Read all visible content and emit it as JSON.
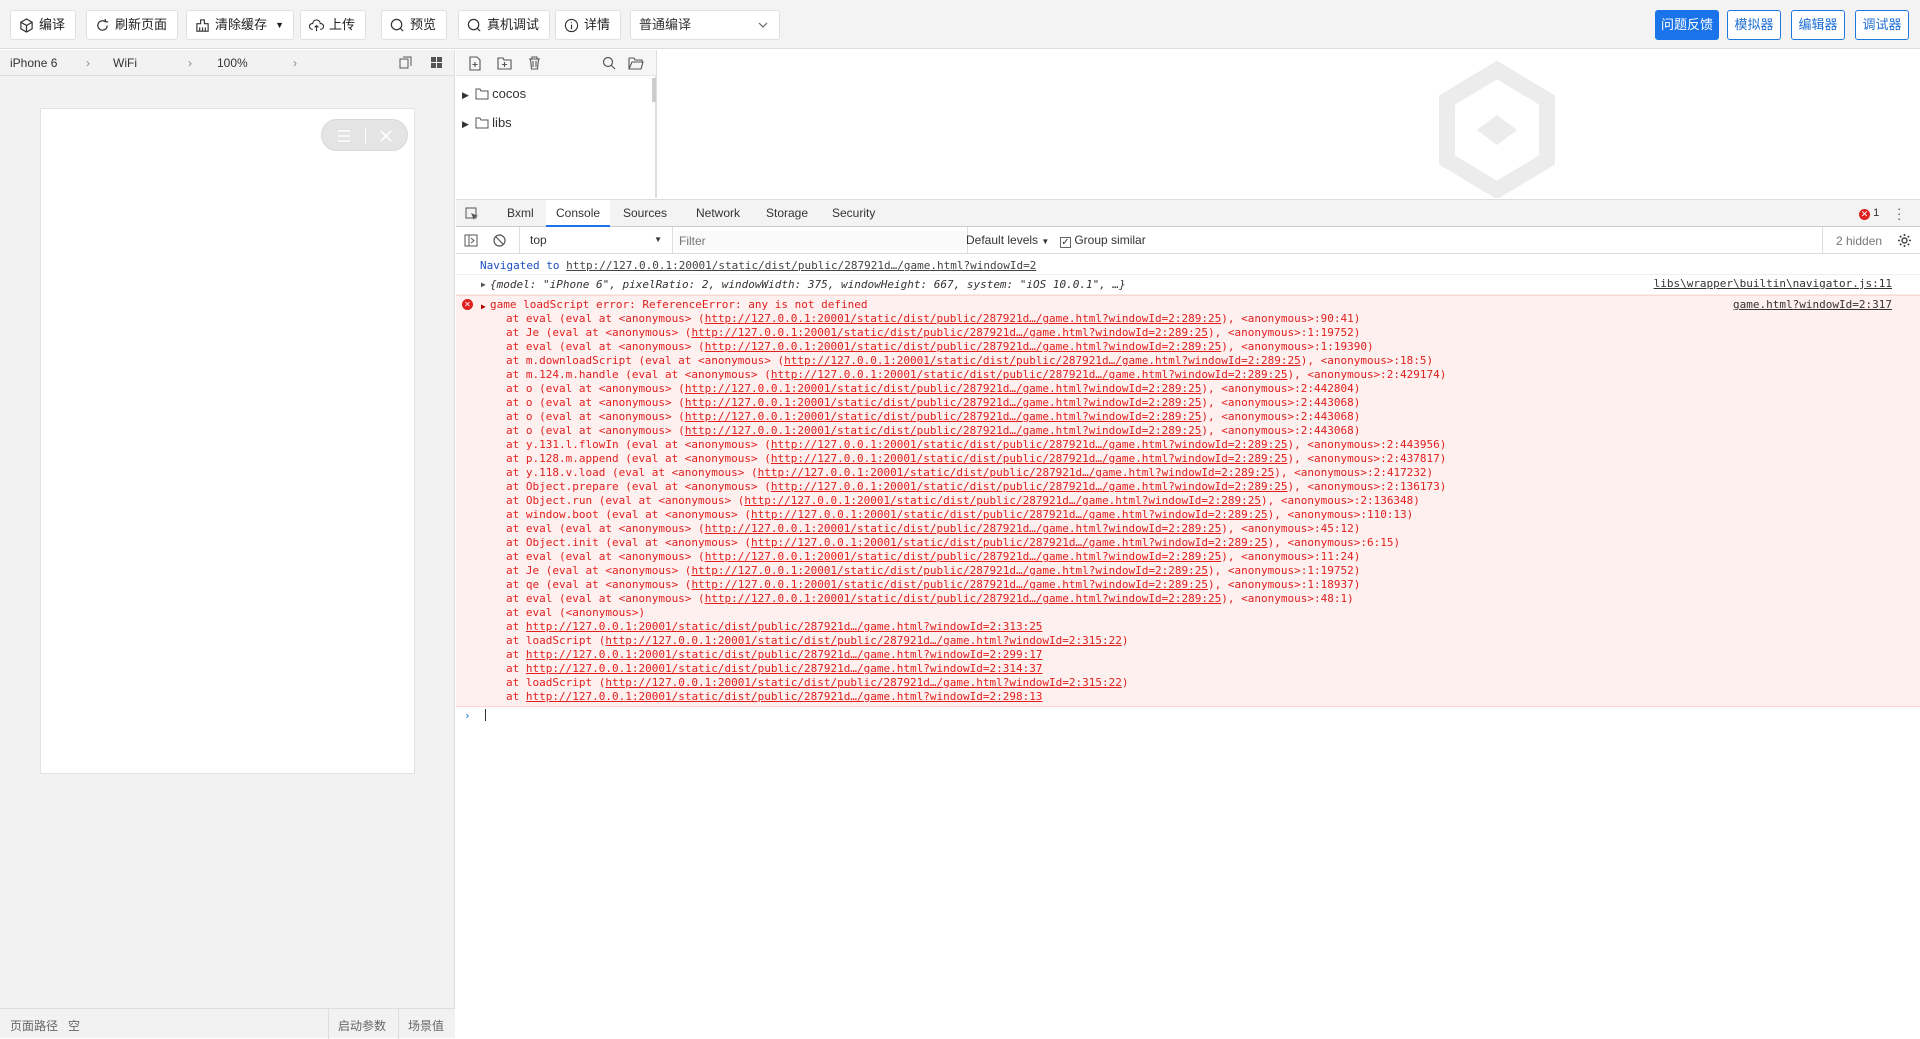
{
  "toolbar": {
    "compile": "编译",
    "refresh": "刷新页面",
    "clear_cache": "清除缓存",
    "upload": "上传",
    "preview": "预览",
    "remote_debug": "真机调试",
    "details": "详情",
    "compile_mode": "普通编译",
    "feedback": "问题反馈",
    "simulator": "模拟器",
    "editor": "编辑器",
    "debugger": "调试器"
  },
  "sim": {
    "device": "iPhone 6",
    "network": "WiFi",
    "zoom": "100%",
    "foot_path_label": "页面路径",
    "foot_path_value": "空",
    "foot_launch": "启动参数",
    "foot_scene": "场景值"
  },
  "filetree": {
    "items": [
      "cocos",
      "libs"
    ]
  },
  "devtools": {
    "tabs": [
      "Bxml",
      "Console",
      "Sources",
      "Network",
      "Storage",
      "Security"
    ],
    "active_tab": "Console",
    "error_count": "1",
    "context": "top",
    "filter_placeholder": "Filter",
    "levels": "Default levels",
    "group_similar": "Group similar",
    "hidden": "2 hidden"
  },
  "console": {
    "nav_prefix": "Navigated to",
    "nav_url": "http://127.0.0.1:20001/static/dist/public/287921d…/game.html?windowId=2",
    "obj_text": "{model: \"iPhone 6\", pixelRatio: 2, windowWidth: 375, windowHeight: 667, system: \"iOS 10.0.1\", …}",
    "obj_src": "libs\\wrapper\\builtin\\navigator.js:11",
    "error_msg": "game loadScript error: ReferenceError: any is not defined",
    "error_src": "game.html?windowId=2:317",
    "stack": [
      {
        "pre": "at eval (eval at <anonymous> (",
        "url": "http://127.0.0.1:20001/static/dist/public/287921d…/game.html?windowId=2:289:25",
        "post": "), <anonymous>:90:41)"
      },
      {
        "pre": "at Je (eval at <anonymous> (",
        "url": "http://127.0.0.1:20001/static/dist/public/287921d…/game.html?windowId=2:289:25",
        "post": "), <anonymous>:1:19752)"
      },
      {
        "pre": "at eval (eval at <anonymous> (",
        "url": "http://127.0.0.1:20001/static/dist/public/287921d…/game.html?windowId=2:289:25",
        "post": "), <anonymous>:1:19390)"
      },
      {
        "pre": "at m.downloadScript (eval at <anonymous> (",
        "url": "http://127.0.0.1:20001/static/dist/public/287921d…/game.html?windowId=2:289:25",
        "post": "), <anonymous>:18:5)"
      },
      {
        "pre": "at m.124.m.handle (eval at <anonymous> (",
        "url": "http://127.0.0.1:20001/static/dist/public/287921d…/game.html?windowId=2:289:25",
        "post": "), <anonymous>:2:429174)"
      },
      {
        "pre": "at o (eval at <anonymous> (",
        "url": "http://127.0.0.1:20001/static/dist/public/287921d…/game.html?windowId=2:289:25",
        "post": "), <anonymous>:2:442804)"
      },
      {
        "pre": "at o (eval at <anonymous> (",
        "url": "http://127.0.0.1:20001/static/dist/public/287921d…/game.html?windowId=2:289:25",
        "post": "), <anonymous>:2:443068)"
      },
      {
        "pre": "at o (eval at <anonymous> (",
        "url": "http://127.0.0.1:20001/static/dist/public/287921d…/game.html?windowId=2:289:25",
        "post": "), <anonymous>:2:443068)"
      },
      {
        "pre": "at o (eval at <anonymous> (",
        "url": "http://127.0.0.1:20001/static/dist/public/287921d…/game.html?windowId=2:289:25",
        "post": "), <anonymous>:2:443068)"
      },
      {
        "pre": "at y.131.l.flowIn (eval at <anonymous> (",
        "url": "http://127.0.0.1:20001/static/dist/public/287921d…/game.html?windowId=2:289:25",
        "post": "), <anonymous>:2:443956)"
      },
      {
        "pre": "at p.128.m.append (eval at <anonymous> (",
        "url": "http://127.0.0.1:20001/static/dist/public/287921d…/game.html?windowId=2:289:25",
        "post": "), <anonymous>:2:437817)"
      },
      {
        "pre": "at y.118.v.load (eval at <anonymous> (",
        "url": "http://127.0.0.1:20001/static/dist/public/287921d…/game.html?windowId=2:289:25",
        "post": "), <anonymous>:2:417232)"
      },
      {
        "pre": "at Object.prepare (eval at <anonymous> (",
        "url": "http://127.0.0.1:20001/static/dist/public/287921d…/game.html?windowId=2:289:25",
        "post": "), <anonymous>:2:136173)"
      },
      {
        "pre": "at Object.run (eval at <anonymous> (",
        "url": "http://127.0.0.1:20001/static/dist/public/287921d…/game.html?windowId=2:289:25",
        "post": "), <anonymous>:2:136348)"
      },
      {
        "pre": "at window.boot (eval at <anonymous> (",
        "url": "http://127.0.0.1:20001/static/dist/public/287921d…/game.html?windowId=2:289:25",
        "post": "), <anonymous>:110:13)"
      },
      {
        "pre": "at eval (eval at <anonymous> (",
        "url": "http://127.0.0.1:20001/static/dist/public/287921d…/game.html?windowId=2:289:25",
        "post": "), <anonymous>:45:12)"
      },
      {
        "pre": "at Object.init (eval at <anonymous> (",
        "url": "http://127.0.0.1:20001/static/dist/public/287921d…/game.html?windowId=2:289:25",
        "post": "), <anonymous>:6:15)"
      },
      {
        "pre": "at eval (eval at <anonymous> (",
        "url": "http://127.0.0.1:20001/static/dist/public/287921d…/game.html?windowId=2:289:25",
        "post": "), <anonymous>:11:24)"
      },
      {
        "pre": "at Je (eval at <anonymous> (",
        "url": "http://127.0.0.1:20001/static/dist/public/287921d…/game.html?windowId=2:289:25",
        "post": "), <anonymous>:1:19752)"
      },
      {
        "pre": "at qe (eval at <anonymous> (",
        "url": "http://127.0.0.1:20001/static/dist/public/287921d…/game.html?windowId=2:289:25",
        "post": "), <anonymous>:1:18937)"
      },
      {
        "pre": "at eval (eval at <anonymous> (",
        "url": "http://127.0.0.1:20001/static/dist/public/287921d…/game.html?windowId=2:289:25",
        "post": "), <anonymous>:48:1)"
      },
      {
        "pre": "at eval (<anonymous>)",
        "url": "",
        "post": ""
      },
      {
        "pre": "at ",
        "url": "http://127.0.0.1:20001/static/dist/public/287921d…/game.html?windowId=2:313:25",
        "post": ""
      },
      {
        "pre": "at loadScript (",
        "url": "http://127.0.0.1:20001/static/dist/public/287921d…/game.html?windowId=2:315:22",
        "post": ")"
      },
      {
        "pre": "at ",
        "url": "http://127.0.0.1:20001/static/dist/public/287921d…/game.html?windowId=2:299:17",
        "post": ""
      },
      {
        "pre": "at ",
        "url": "http://127.0.0.1:20001/static/dist/public/287921d…/game.html?windowId=2:314:37",
        "post": ""
      },
      {
        "pre": "at loadScript (",
        "url": "http://127.0.0.1:20001/static/dist/public/287921d…/game.html?windowId=2:315:22",
        "post": ")"
      },
      {
        "pre": "at ",
        "url": "http://127.0.0.1:20001/static/dist/public/287921d…/game.html?windowId=2:298:13",
        "post": ""
      }
    ]
  },
  "colors": {
    "accent": "#1a73e8",
    "error": "#e0201e",
    "error_bg": "#fff0f0"
  }
}
